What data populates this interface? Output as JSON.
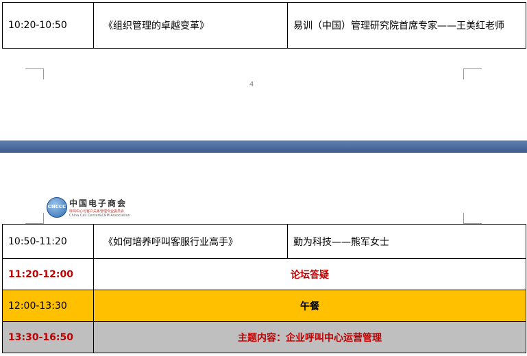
{
  "top_table": {
    "time": "10:20-10:50",
    "topic": "《组织管理的卓越变革》",
    "speaker": "易训（中国）管理研究院首席专家——王美红老师"
  },
  "page_number": "4",
  "logo": {
    "name_cn": "中国电子商会",
    "badge": "CNCCC",
    "subtitle_cn": "呼叫中心与客户关系管理专业委员会",
    "subtitle_en": "China Call Center&CRM Association"
  },
  "schedule": [
    {
      "time": "10:50-11:20",
      "topic": "《如何培养呼叫客服行业高手》",
      "speaker": "勤为科技——熊军女士"
    },
    {
      "time": "11:20-12:00",
      "label": "论坛答疑"
    },
    {
      "time": "12:00-13:30",
      "label": "午餐"
    },
    {
      "time": "13:30-16:50",
      "label": "主题内容：企业呼叫中心运营管理"
    }
  ],
  "colors": {
    "highlight_red": "#c00000",
    "lunch_bg": "#ffc000",
    "section_bg": "#bfbfbf",
    "page_gap": "#4a6b9c"
  }
}
